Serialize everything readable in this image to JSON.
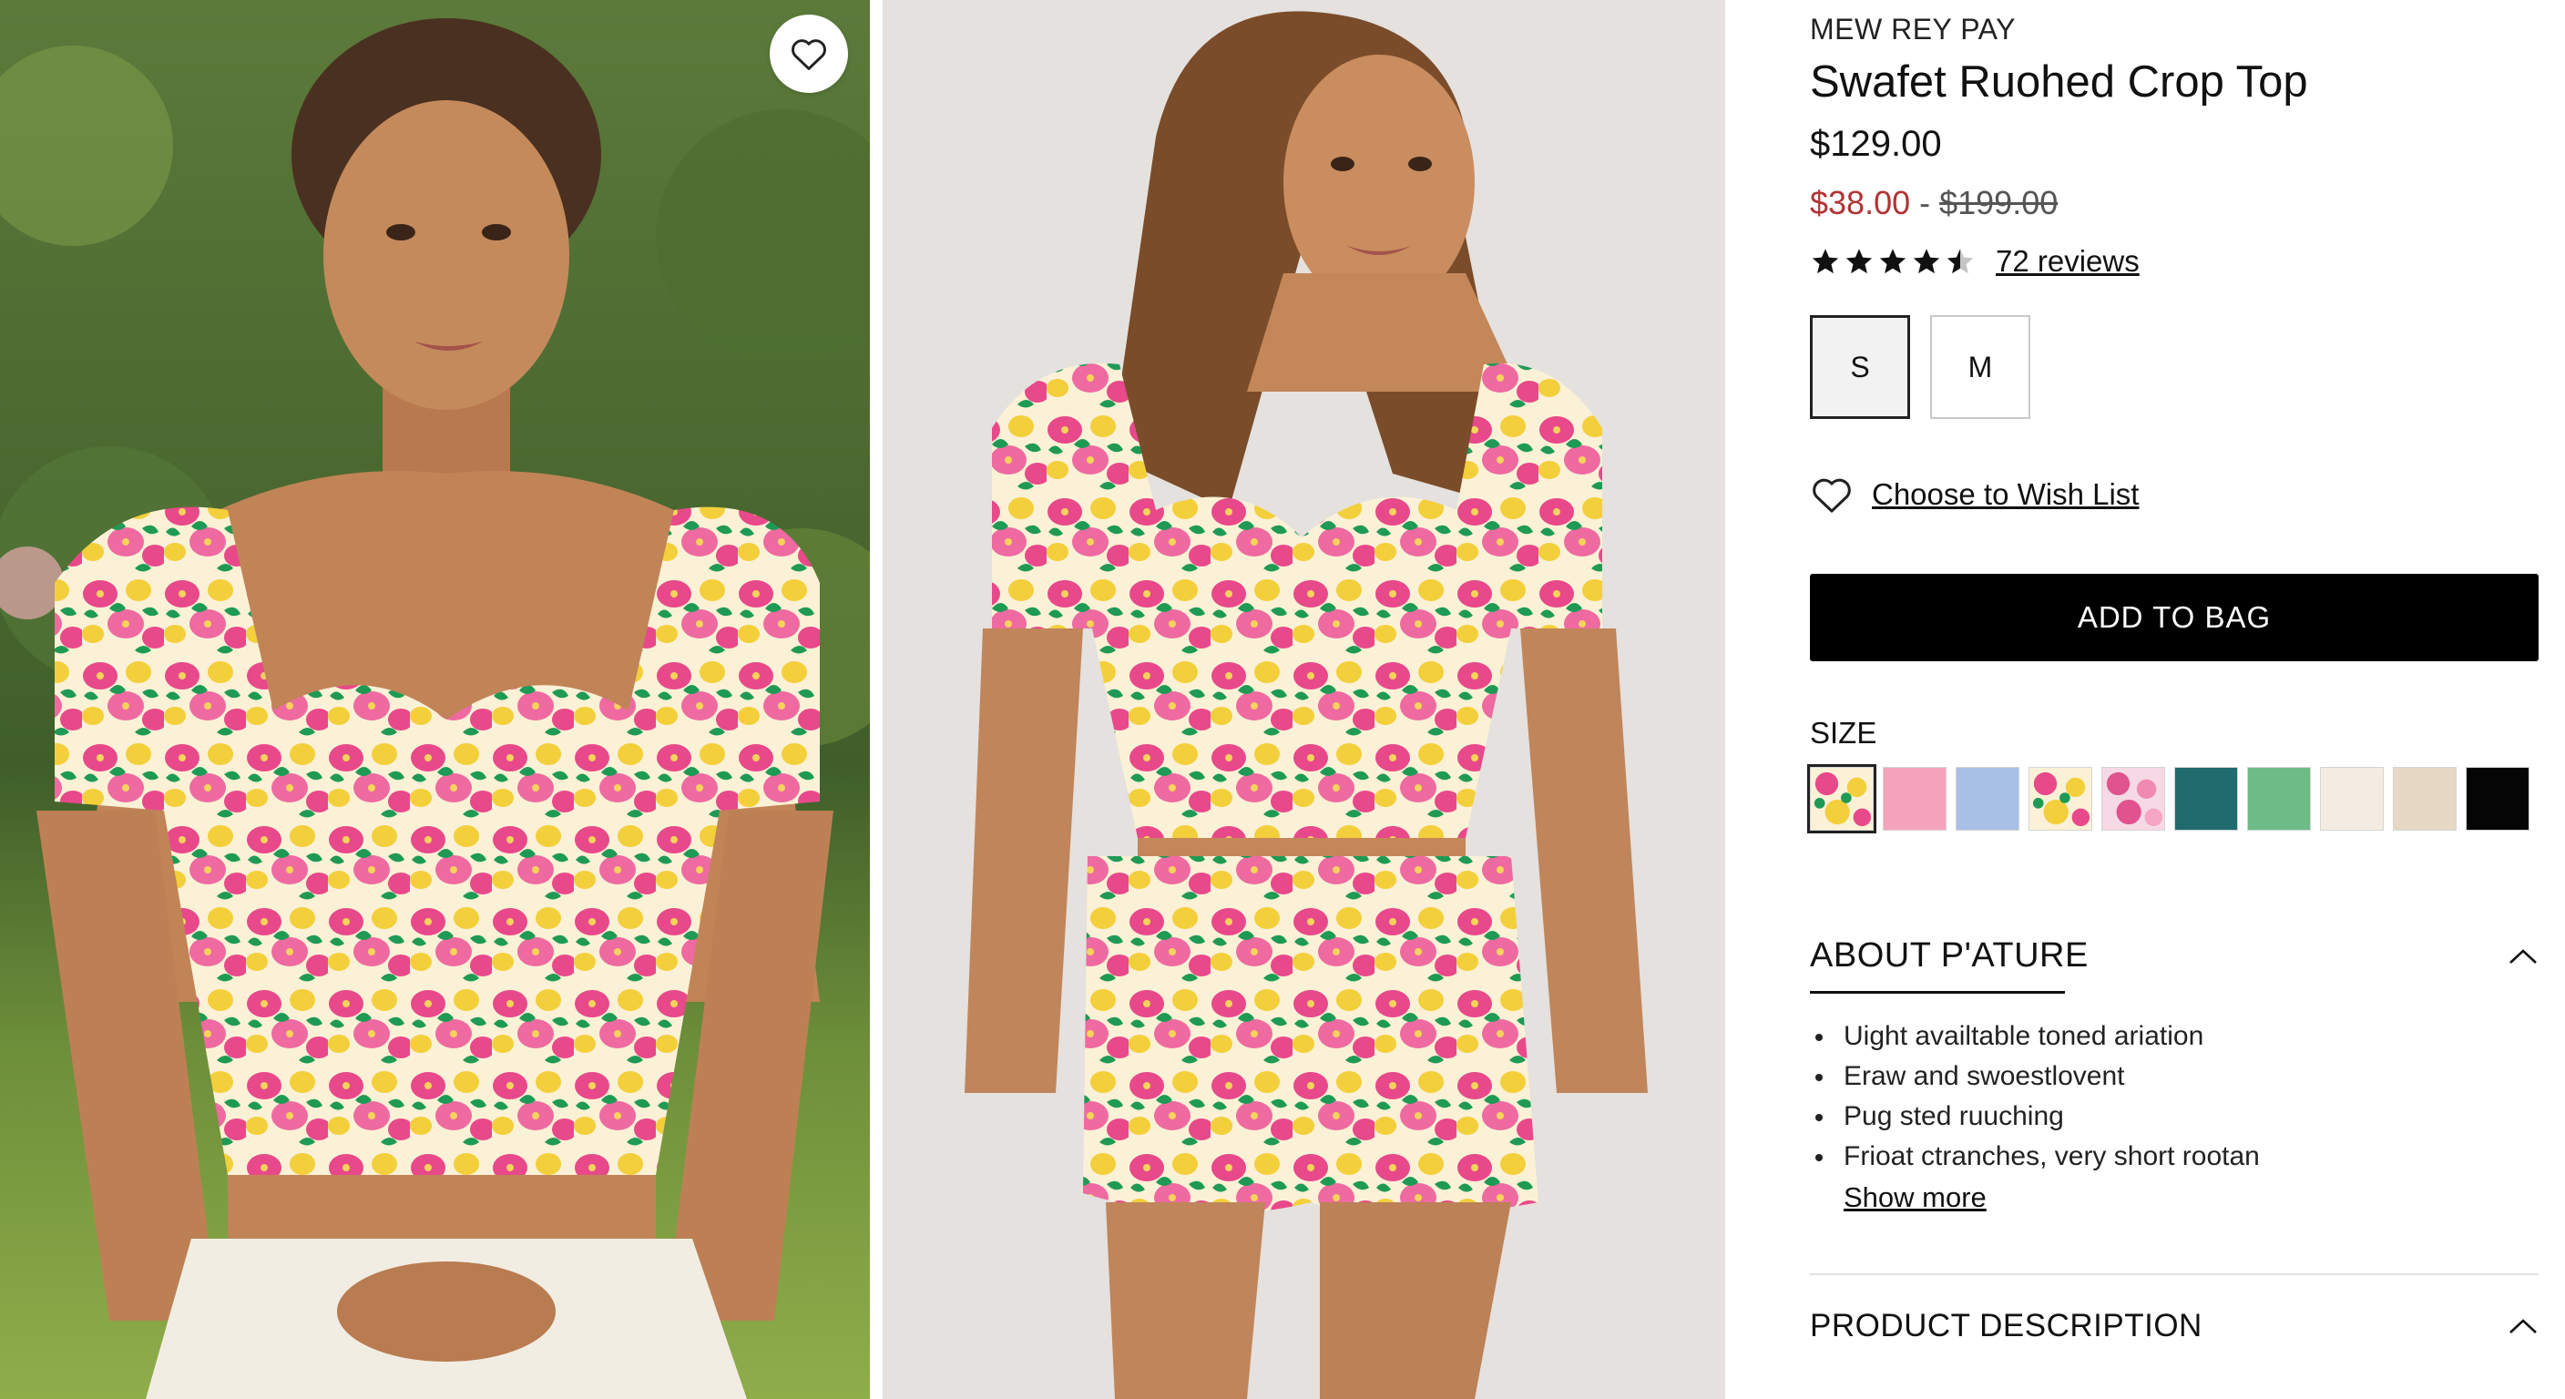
{
  "gallery": {
    "images": [
      {
        "alt": "model-front-view-garden"
      },
      {
        "alt": "model-full-outfit-studio"
      }
    ],
    "wishlist_icon": "heart-icon"
  },
  "product": {
    "brand": "MEW REY PAY",
    "title": "Swafet Ruohed Crop Top",
    "price": "$129.00",
    "sale_price": "$38.00",
    "sale_separator": "-",
    "original_price": "$199.00",
    "rating": 4.5,
    "reviews_label": "72 reviews",
    "sizes": [
      {
        "label": "S",
        "selected": true
      },
      {
        "label": "M",
        "selected": false
      }
    ],
    "wishlist_label": "Choose to Wish List",
    "add_to_bag_label": "ADD TO BAG",
    "swatch_section_label": "SIZE",
    "swatches": [
      {
        "name": "floral-multicolor",
        "color": "#f5e28a",
        "selected": true
      },
      {
        "name": "pink",
        "color": "#f4a3ba",
        "selected": false
      },
      {
        "name": "light-blue",
        "color": "#a8bfe6",
        "selected": false
      },
      {
        "name": "yellow-floral",
        "color": "#f2d24a",
        "selected": false
      },
      {
        "name": "pink-floral",
        "color": "#f3c6d6",
        "selected": false
      },
      {
        "name": "teal",
        "color": "#1f6b6e",
        "selected": false
      },
      {
        "name": "green",
        "color": "#6dbb86",
        "selected": false
      },
      {
        "name": "cream",
        "color": "#f4ece2",
        "selected": false
      },
      {
        "name": "beige-satin",
        "color": "#e6d8c4",
        "selected": false
      },
      {
        "name": "black",
        "color": "#050505",
        "selected": false
      }
    ],
    "about": {
      "title": "ABOUT P'ATURE",
      "expanded": true,
      "features": [
        "Uight availtable toned ariation",
        "Eraw and swoestlovent",
        "Pug sted ruuching",
        "Frioat ctranches, very short rootan"
      ],
      "show_more_label": "Show more"
    },
    "description": {
      "title": "PRODUCT DESCRIPTION"
    }
  },
  "colors": {
    "sale": "#b03434",
    "button_bg": "#000000",
    "button_text": "#ffffff",
    "print_pink": "#e8498a",
    "print_yellow": "#f3cf3b",
    "print_green": "#1f9a55",
    "print_cream": "#fbf1d6"
  }
}
